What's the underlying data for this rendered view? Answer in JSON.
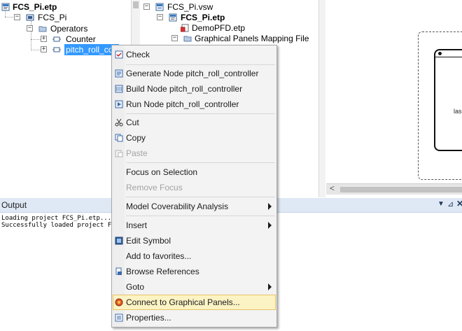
{
  "left_tree": {
    "root_label": "FCS_Pi.etp",
    "project_label": "FCS_Pi",
    "operators_label": "Operators",
    "counter_label": "Counter",
    "selected_label": "pitch_roll_con"
  },
  "mid_tree": {
    "root_label": "FCS_Pi.vsw",
    "project_label": "FCS_Pi.etp",
    "demo_label": "DemoPFD.etp",
    "panels_label": "Graphical Panels Mapping File"
  },
  "canvas": {
    "panel_text": "las"
  },
  "output": {
    "title": "Output",
    "lines": [
      "Loading project FCS_Pi.etp...",
      "Successfully loaded project FC"
    ]
  },
  "menu": {
    "items": [
      {
        "label": "Check",
        "icon": "check-icon"
      },
      {
        "label": "Generate Node pitch_roll_controller",
        "icon": "generate-icon"
      },
      {
        "label": "Build Node pitch_roll_controller",
        "icon": "build-icon"
      },
      {
        "label": "Run Node pitch_roll_controller",
        "icon": "run-icon"
      },
      {
        "label": "Cut",
        "icon": "scissors-icon"
      },
      {
        "label": "Copy",
        "icon": "copy-icon"
      },
      {
        "label": "Paste",
        "icon": "paste-icon",
        "disabled": true
      },
      {
        "label": "Focus on Selection"
      },
      {
        "label": "Remove Focus",
        "disabled": true
      },
      {
        "label": "Model Coverability Analysis",
        "submenu": true
      },
      {
        "label": "Insert",
        "submenu": true
      },
      {
        "label": "Edit Symbol",
        "icon": "edit-symbol-icon"
      },
      {
        "label": "Add to favorites..."
      },
      {
        "label": "Browse References",
        "icon": "browse-icon"
      },
      {
        "label": "Goto",
        "submenu": true
      },
      {
        "label": "Connect to Graphical Panels...",
        "icon": "connect-icon",
        "highlighted": true
      },
      {
        "label": "Properties...",
        "icon": "properties-icon"
      }
    ]
  },
  "colors": {
    "selection": "#3399ff",
    "menu_highlight": "#fcf3c4",
    "output_header": "#dfe8f5"
  }
}
